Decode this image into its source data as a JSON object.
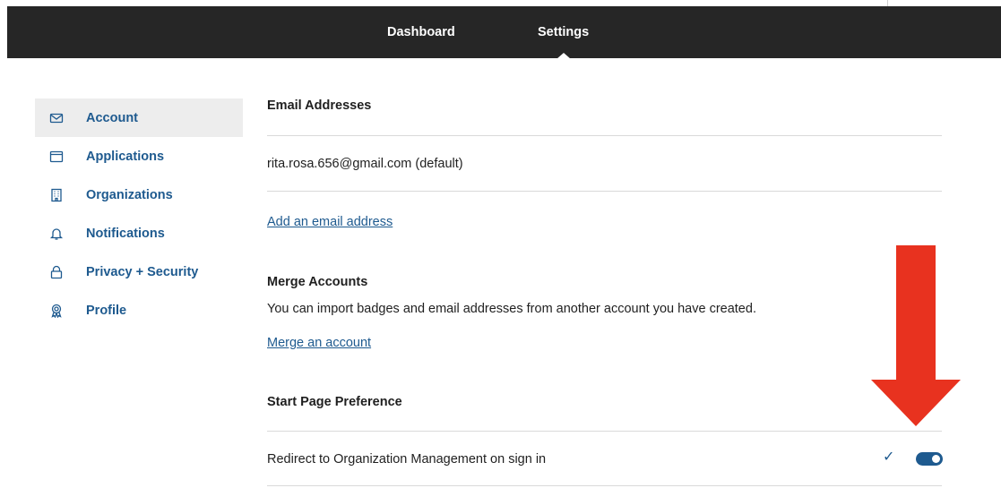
{
  "topnav": {
    "dashboard": "Dashboard",
    "settings": "Settings"
  },
  "sidebar": {
    "items": [
      {
        "label": "Account",
        "icon": "envelope-icon",
        "active": true
      },
      {
        "label": "Applications",
        "icon": "window-icon"
      },
      {
        "label": "Organizations",
        "icon": "building-icon"
      },
      {
        "label": "Notifications",
        "icon": "bell-icon"
      },
      {
        "label": "Privacy + Security",
        "icon": "lock-icon"
      },
      {
        "label": "Profile",
        "icon": "badge-icon"
      }
    ]
  },
  "main": {
    "email_heading": "Email Addresses",
    "email_value": "rita.rosa.656@gmail.com (default)",
    "add_email_link": "Add an email address",
    "merge_heading": "Merge Accounts",
    "merge_text": "You can import badges and email addresses from another account you have created.",
    "merge_link": "Merge an account",
    "start_heading": "Start Page Preference",
    "redirect_label": "Redirect to Organization Management on sign in",
    "redirect_enabled": true
  },
  "colors": {
    "topbar": "#262626",
    "accent": "#1e5a8f",
    "annotation_arrow": "#e8321f"
  }
}
